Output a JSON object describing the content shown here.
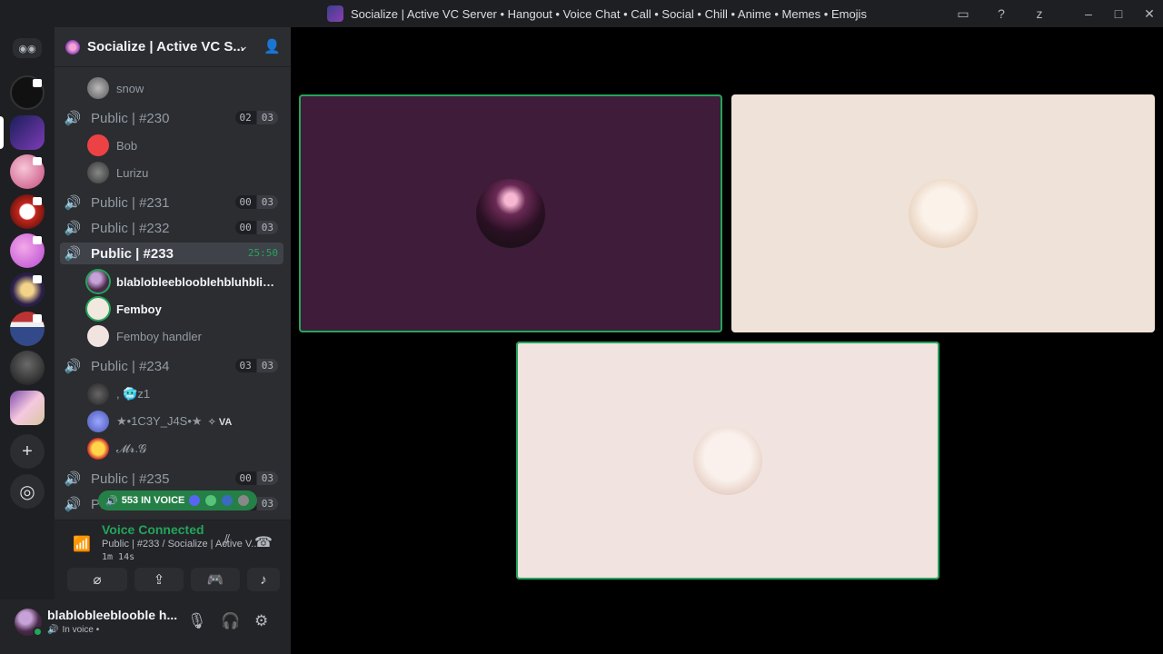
{
  "window": {
    "title": "Socialize | Active VC Server • Hangout • Voice Chat • Call • Social • Chill • Anime • Memes • Emojis"
  },
  "guild": {
    "name": "Socialize | Active VC S..."
  },
  "channels": [
    {
      "name": "Public | #230",
      "count_a": "02",
      "count_b": "03"
    },
    {
      "name": "Public | #231",
      "count_a": "00",
      "count_b": "03"
    },
    {
      "name": "Public | #232",
      "count_a": "00",
      "count_b": "03"
    },
    {
      "name": "Public | #233",
      "timer": "25:50"
    },
    {
      "name": "Public | #234",
      "count_a": "03",
      "count_b": "03"
    },
    {
      "name": "Public | #235",
      "count_a": "00",
      "count_b": "03"
    },
    {
      "name": "Pu",
      "count_a": "00",
      "count_b": "03"
    }
  ],
  "members": {
    "top": [
      "snow"
    ],
    "c230": [
      "Bob",
      "Lurizu"
    ],
    "c233": [
      "blablobleeblooblehbluhblible...",
      "Femboy",
      "Femboy handler"
    ],
    "c234": [
      ", 🥶z1",
      "★•1C3Y_J4S•★",
      "𝓜𝓻.𝓖"
    ],
    "c234_tag": "✧ VA"
  },
  "voice_pill": {
    "label": "553 IN VOICE"
  },
  "voice_panel": {
    "status": "Voice Connected",
    "channel": "Public | #233 / Socialize | Active V...",
    "elapsed": "1m 14s"
  },
  "user": {
    "name": "blablobleeblooble h...",
    "status": "In voice •"
  },
  "colors": {
    "speaking": "#23a55a",
    "tile1": "#3f1c39",
    "tile2": "#efe2d8",
    "tile3": "#f1e3df"
  }
}
